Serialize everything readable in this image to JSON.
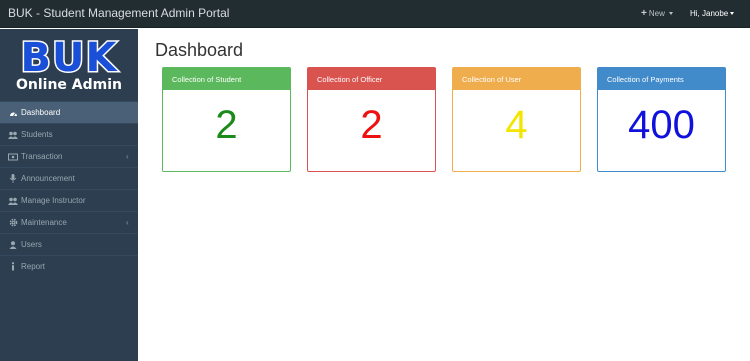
{
  "header": {
    "title": "BUK - Student Management Admin Portal",
    "new_label": "New",
    "user_greeting": "Hi, Janobe"
  },
  "logo": {
    "line1": "BUK",
    "line2": "Online Admin"
  },
  "sidebar": {
    "items": [
      {
        "label": "Dashboard",
        "icon": "dashboard-icon",
        "active": true
      },
      {
        "label": "Students",
        "icon": "users-icon"
      },
      {
        "label": "Transaction",
        "icon": "transaction-icon",
        "has_submenu": true
      },
      {
        "label": "Announcement",
        "icon": "microphone-icon"
      },
      {
        "label": "Manage Instructor",
        "icon": "users-icon"
      },
      {
        "label": "Maintenance",
        "icon": "gear-icon",
        "has_submenu": true
      },
      {
        "label": "Users",
        "icon": "user-icon"
      },
      {
        "label": "Report",
        "icon": "info-icon"
      }
    ]
  },
  "main": {
    "title": "Dashboard",
    "cards": [
      {
        "title": "Collection of Student",
        "value": "2",
        "header_color": "#5cb85c",
        "border_color": "#5cb85c",
        "value_color": "#1a8a1a"
      },
      {
        "title": "Collection of Officer",
        "value": "2",
        "header_color": "#d9534f",
        "border_color": "#d9534f",
        "value_color": "#ee1111"
      },
      {
        "title": "Collection of User",
        "value": "4",
        "header_color": "#f0ad4e",
        "border_color": "#f0ad4e",
        "value_color": "#f4e500"
      },
      {
        "title": "Collection of Payments",
        "value": "400",
        "header_color": "#428bca",
        "border_color": "#428bca",
        "value_color": "#1111dd"
      }
    ]
  }
}
